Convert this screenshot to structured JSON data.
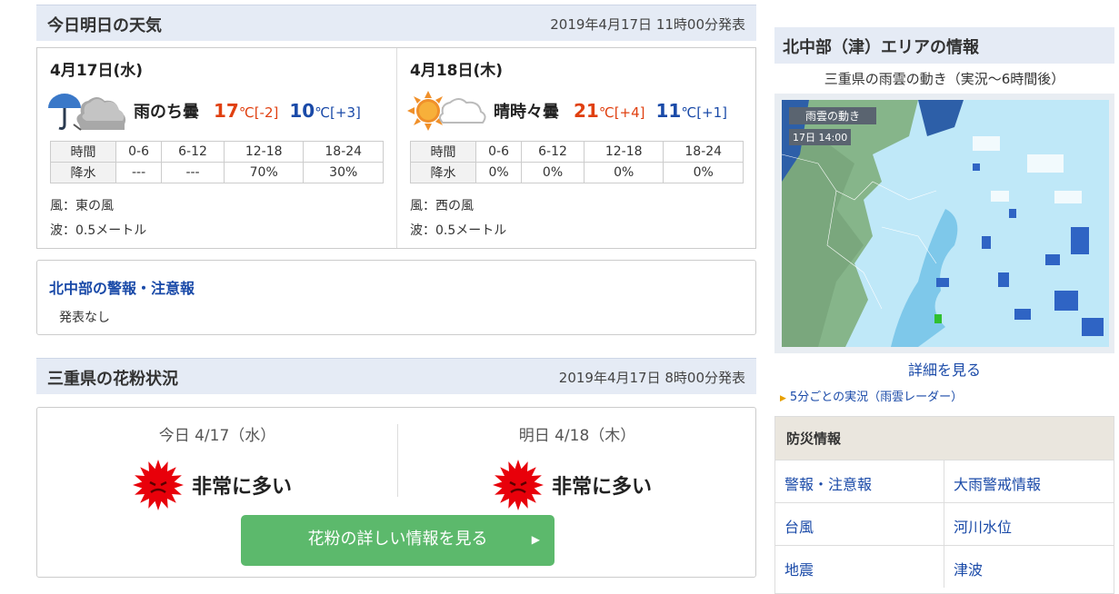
{
  "weather": {
    "title": "今日明日の天気",
    "issued": "2019年4月17日 11時00分発表",
    "days": [
      {
        "date": "4月17日(水)",
        "icon": "umbrella-cloud-icon",
        "telop": "雨のち曇",
        "high": "17",
        "high_unit": "℃[-2]",
        "low": "10",
        "low_unit": "℃[+3]",
        "table": {
          "time_label": "時間",
          "times": [
            "0-6",
            "6-12",
            "12-18",
            "18-24"
          ],
          "rain_label": "降水",
          "rain": [
            "---",
            "---",
            "70%",
            "30%"
          ]
        },
        "wind": "風：東の風",
        "wave": "波：0.5メートル"
      },
      {
        "date": "4月18日(木)",
        "icon": "sun-cloud-icon",
        "telop": "晴時々曇",
        "high": "21",
        "high_unit": "℃[+4]",
        "low": "11",
        "low_unit": "℃[+1]",
        "table": {
          "time_label": "時間",
          "times": [
            "0-6",
            "6-12",
            "12-18",
            "18-24"
          ],
          "rain_label": "降水",
          "rain": [
            "0%",
            "0%",
            "0%",
            "0%"
          ]
        },
        "wind": "風：西の風",
        "wave": "波：0.5メートル"
      }
    ]
  },
  "warning": {
    "title": "北中部の警報・注意報",
    "status": "発表なし"
  },
  "pollen": {
    "title": "三重県の花粉状況",
    "issued": "2019年4月17日 8時00分発表",
    "days": [
      {
        "date": "今日 4/17（水）",
        "level": "非常に多い",
        "icon": "pollen-very-high-icon"
      },
      {
        "date": "明日 4/18（木）",
        "level": "非常に多い",
        "icon": "pollen-very-high-icon"
      }
    ],
    "button": "花粉の詳しい情報を見る"
  },
  "side": {
    "title": "北中部（津）エリアの情報",
    "radar_caption": "三重県の雨雲の動き（実況～6時間後）",
    "radar_label": "雨雲の動き",
    "radar_time": "17日 14:00",
    "detail_link": "詳細を見る",
    "sub_link": "5分ごとの実況（雨雲レーダー）"
  },
  "bousai": {
    "title": "防災情報",
    "items": [
      "警報・注意報",
      "大雨警戒情報",
      "台風",
      "河川水位",
      "地震",
      "津波"
    ]
  },
  "colors": {
    "header_bg": "#e5ebf5",
    "high_temp": "#e04010",
    "low_temp": "#1a4aa8",
    "link": "#1a4aa8",
    "button": "#5cb96c",
    "pollen_red": "#e8000a"
  }
}
